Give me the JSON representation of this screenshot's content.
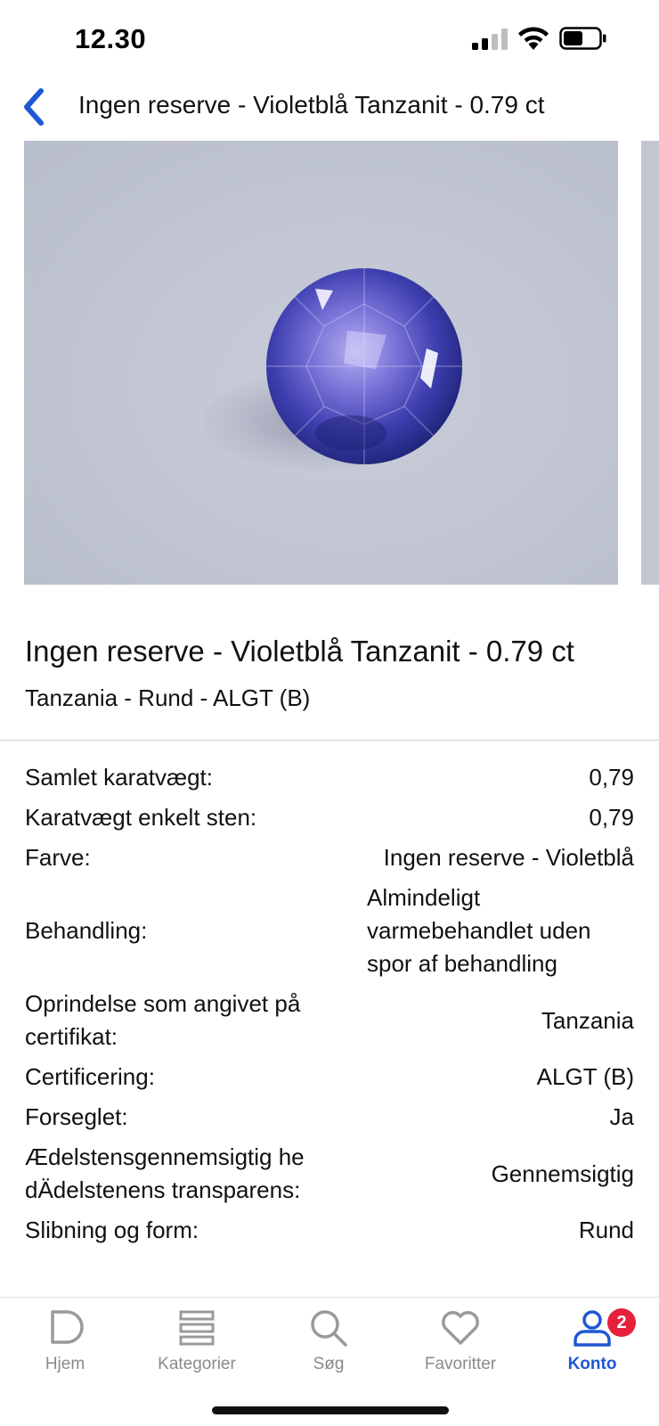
{
  "status_bar": {
    "time": "12.30"
  },
  "nav": {
    "title": "Ingen reserve - Violetblå Tanzanit - 0.79 ct"
  },
  "item": {
    "title": "Ingen reserve - Violetblå Tanzanit - 0.79 ct",
    "subtitle": "Tanzania - Rund - ALGT (B)"
  },
  "specs": [
    {
      "label": "Samlet karatvægt:",
      "value": "0,79"
    },
    {
      "label": "Karatvægt enkelt sten:",
      "value": "0,79"
    },
    {
      "label": "Farve:",
      "value": "Ingen reserve - Violetblå"
    },
    {
      "label": "Behandling:",
      "value": "Almindeligt varmebehandlet uden spor af behandling"
    },
    {
      "label": "Oprindelse som angivet på certifikat:",
      "value": "Tanzania"
    },
    {
      "label": "Certificering:",
      "value": "ALGT (B)"
    },
    {
      "label": "Forseglet:",
      "value": "Ja"
    },
    {
      "label": "Ædelstensgennemsigtig hedÄdelstenens transparens:",
      "value": "Gennemsigtig"
    },
    {
      "label": "Slibning og form:",
      "value": "Rund"
    }
  ],
  "tabs": [
    {
      "label": "Hjem",
      "icon": "home-icon"
    },
    {
      "label": "Kategorier",
      "icon": "categories-icon"
    },
    {
      "label": "Søg",
      "icon": "search-icon"
    },
    {
      "label": "Favoritter",
      "icon": "heart-icon"
    },
    {
      "label": "Konto",
      "icon": "account-icon",
      "badge": "2",
      "active": true
    }
  ],
  "colors": {
    "accent": "#1f57d6",
    "badge": "#e5203a",
    "inactive_tab": "#8a8a8a"
  }
}
